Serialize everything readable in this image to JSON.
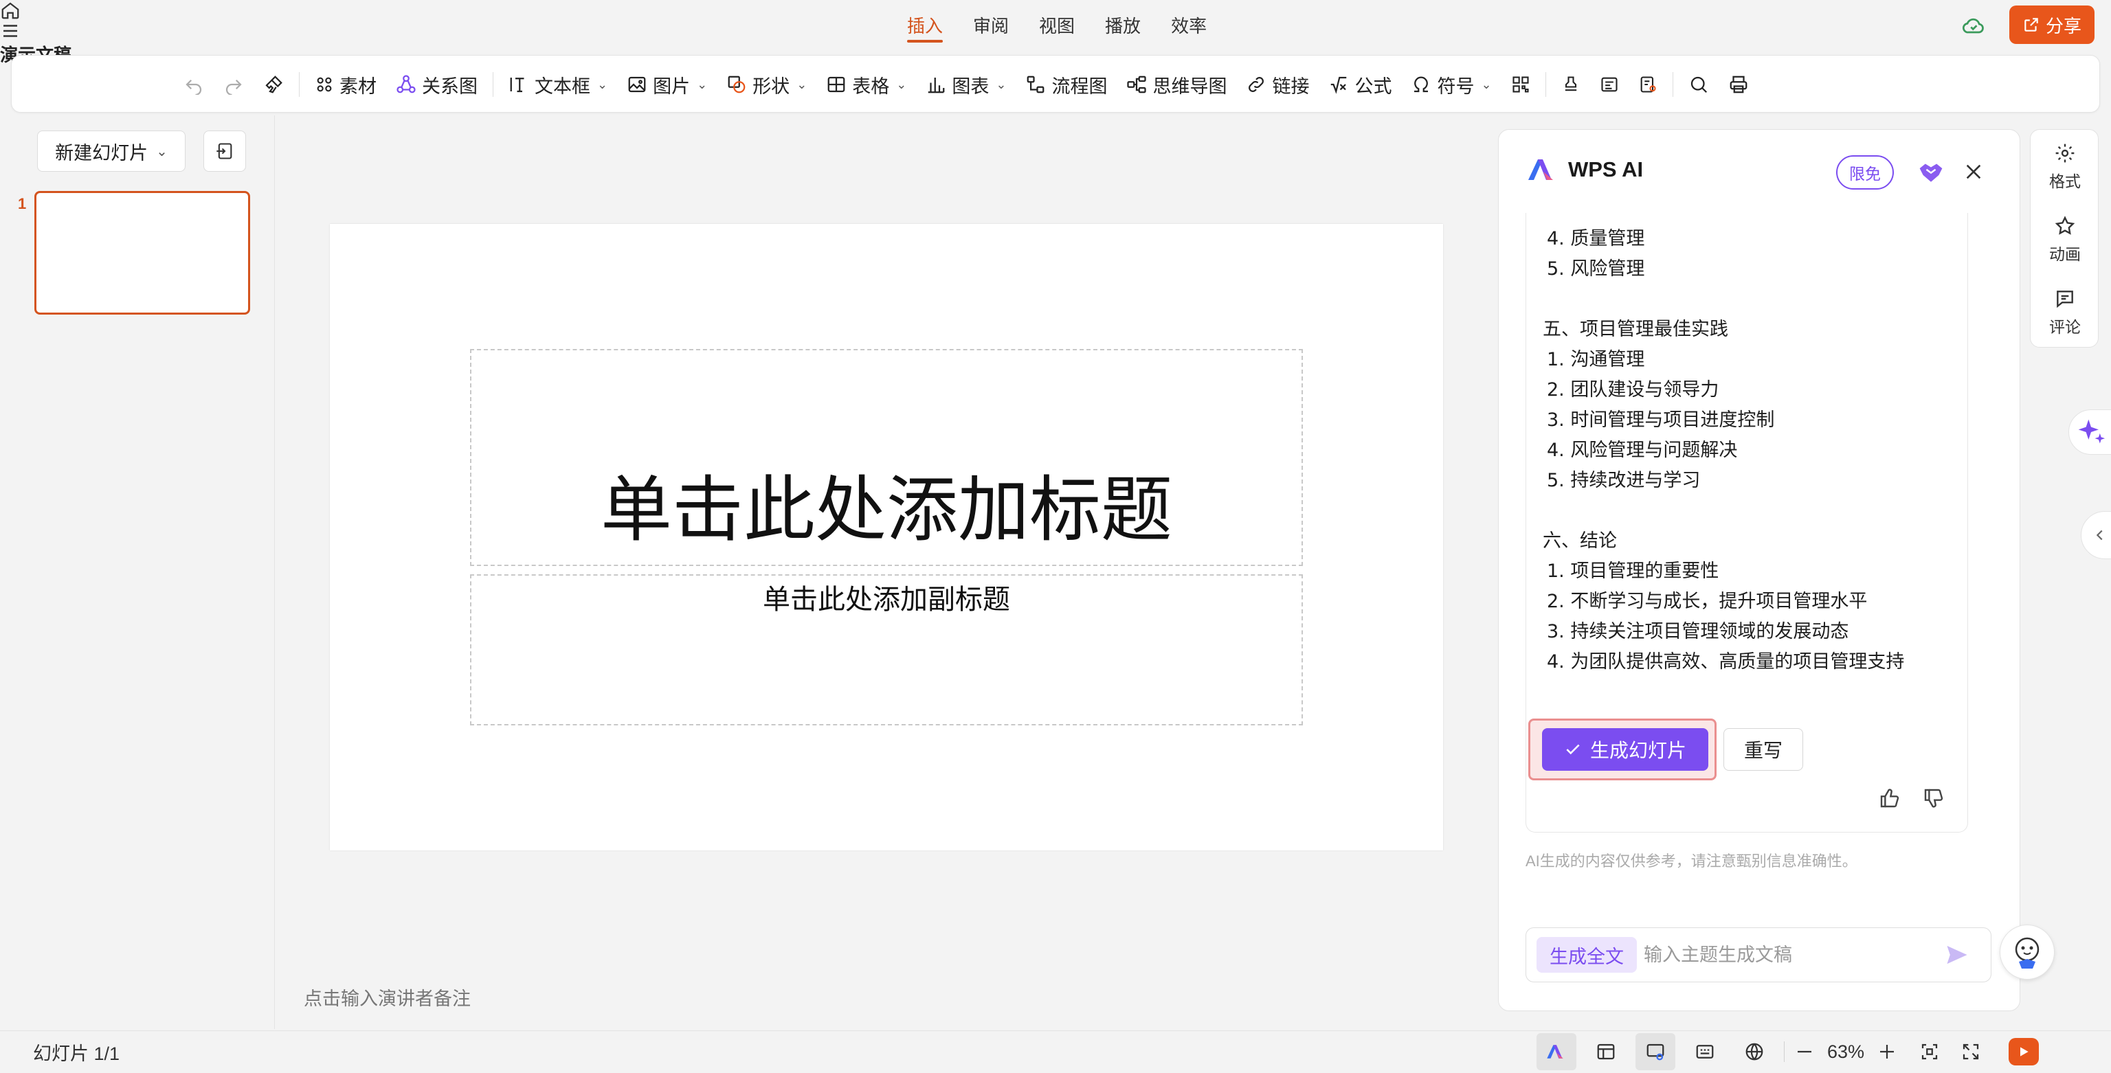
{
  "app": {
    "title": "演示文稿",
    "share_label": "分享"
  },
  "menu_tabs": [
    {
      "label": "插入",
      "active": true
    },
    {
      "label": "审阅"
    },
    {
      "label": "视图"
    },
    {
      "label": "播放"
    },
    {
      "label": "效率"
    }
  ],
  "toolbar": {
    "material": "素材",
    "relation": "关系图",
    "textbox": "文本框",
    "picture": "图片",
    "shape": "形状",
    "table": "表格",
    "chart": "图表",
    "flowchart": "流程图",
    "mindmap": "思维导图",
    "link": "链接",
    "formula": "公式",
    "symbol": "符号"
  },
  "slides_panel": {
    "new_slide": "新建幻灯片",
    "slide_number": "1"
  },
  "slide": {
    "title_placeholder": "单击此处添加标题",
    "subtitle_placeholder": "单击此处添加副标题",
    "notes_placeholder": "点击输入演讲者备注"
  },
  "ai_panel": {
    "title": "WPS AI",
    "badge": "限免",
    "content": {
      "items_top": [
        "4. 质量管理",
        "5. 风险管理"
      ],
      "section5": "五、项目管理最佳实践",
      "section5_items": [
        "1. 沟通管理",
        "2. 团队建设与领导力",
        "3. 时间管理与项目进度控制",
        "4. 风险管理与问题解决",
        "5. 持续改进与学习"
      ],
      "section6": "六、结论",
      "section6_items": [
        "1. 项目管理的重要性",
        "2. 不断学习与成长，提升项目管理水平",
        "3. 持续关注项目管理领域的发展动态",
        "4. 为团队提供高效、高质量的项目管理支持"
      ]
    },
    "generate_label": "生成幻灯片",
    "rewrite_label": "重写",
    "disclaimer": "AI生成的内容仅供参考，请注意甄别信息准确性。",
    "input_tag": "生成全文",
    "input_placeholder": "输入主题生成文稿"
  },
  "rail": {
    "format": "格式",
    "animation": "动画",
    "comment": "评论"
  },
  "statusbar": {
    "slide_counter": "幻灯片 1/1",
    "zoom": "63%"
  },
  "colors": {
    "accent": "#e8561b",
    "ai_purple": "#7b4df0",
    "highlight": "#ea8f8f"
  },
  "icons": [
    "home-icon",
    "hamburger-icon",
    "cloud-check-icon",
    "share-icon",
    "undo-icon",
    "redo-icon",
    "format-painter-icon",
    "search-icon",
    "print-icon",
    "thumb-up-icon",
    "thumb-down-icon",
    "send-icon",
    "close-icon",
    "sparkle-icon"
  ]
}
